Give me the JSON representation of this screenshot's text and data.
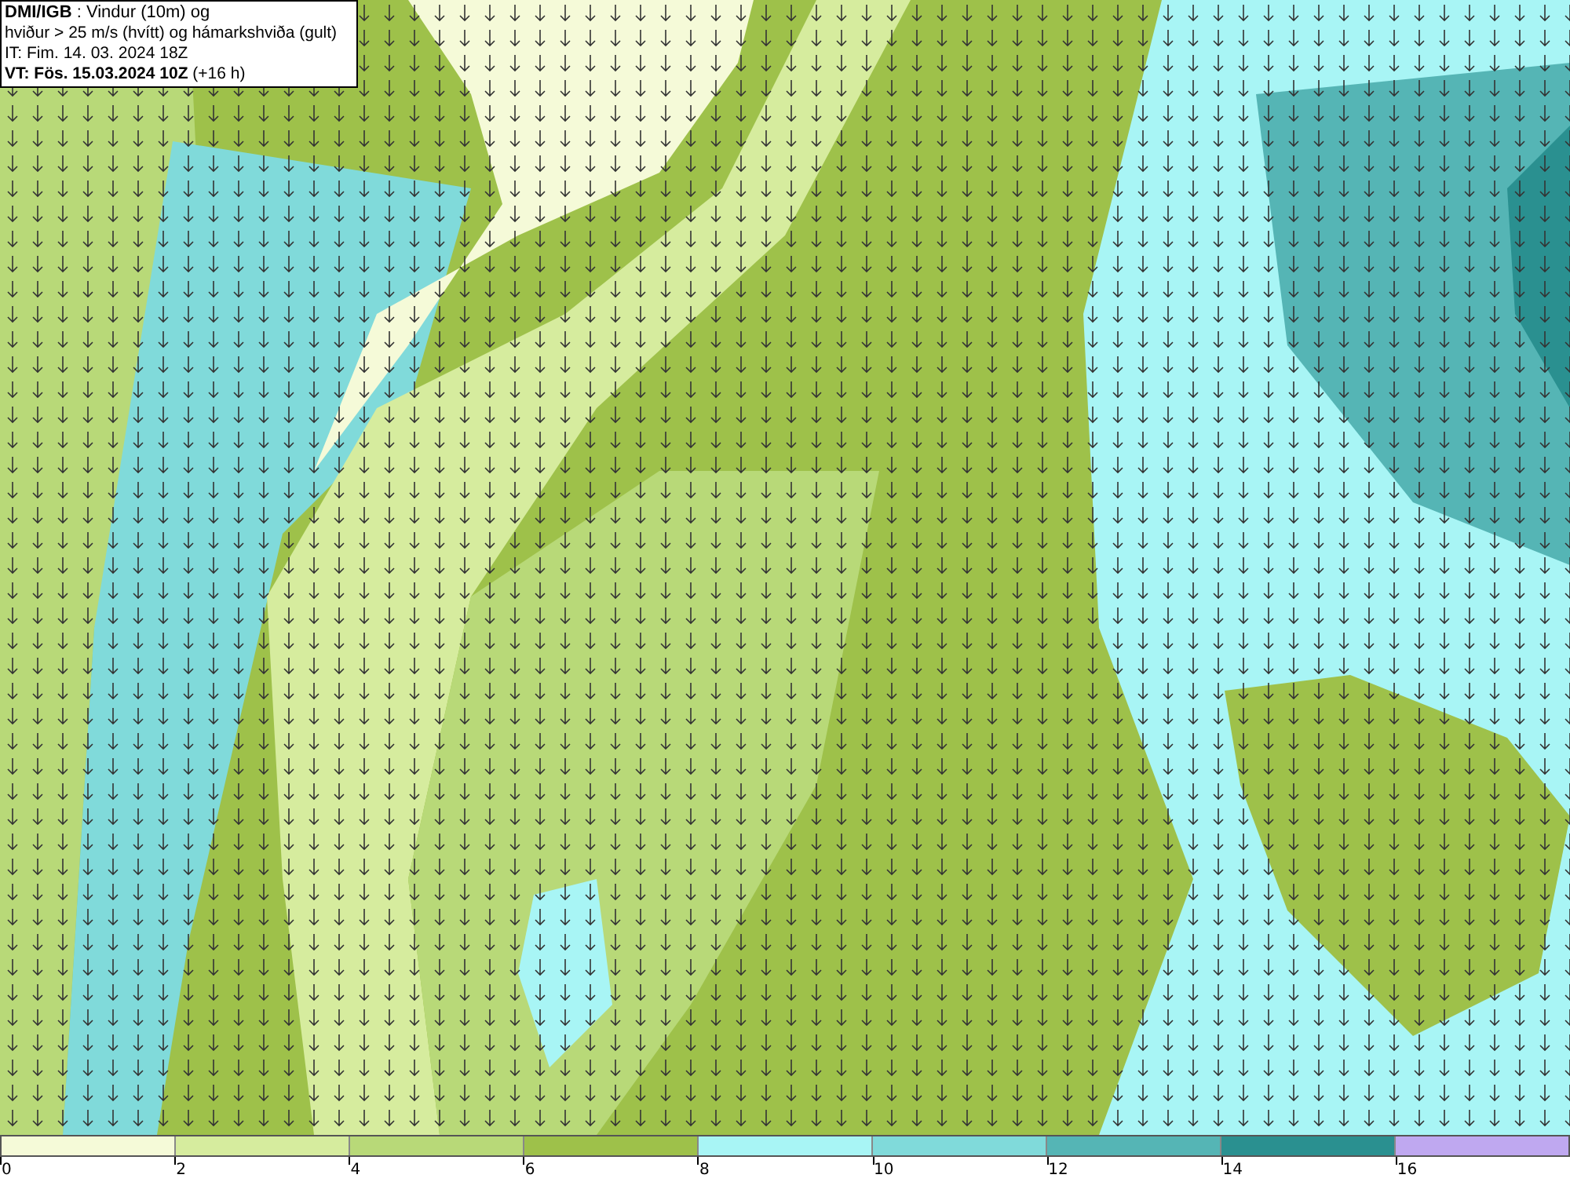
{
  "header": {
    "lines": [
      "**DMI/IGB** : Vindur (10m) og",
      "hviður > 25 m/s (hvítt) og hámarkshviða (gult)",
      "IT: Fim. 14. 03. 2024 18Z",
      "**VT: Fös. 15.03.2024 10Z** (+16 h)"
    ]
  },
  "legend": {
    "bins": [
      {
        "label": "0",
        "color": "#f5fad8"
      },
      {
        "label": "2",
        "color": "#d6ec9e"
      },
      {
        "label": "4",
        "color": "#b8d978"
      },
      {
        "label": "6",
        "color": "#9ec14a"
      },
      {
        "label": "8",
        "color": "#a8f5f5"
      },
      {
        "label": "10",
        "color": "#80dada"
      },
      {
        "label": "12",
        "color": "#55b5b5"
      },
      {
        "label": "14",
        "color": "#2a9090"
      },
      {
        "label": "16",
        "color": "#bfa8f0"
      }
    ]
  }
}
